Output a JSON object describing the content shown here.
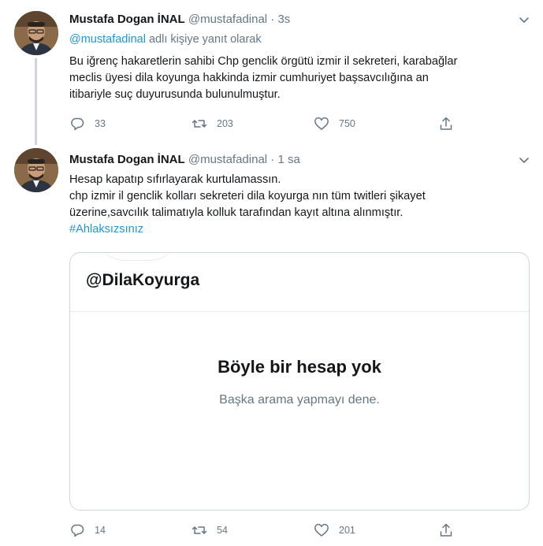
{
  "tweets": [
    {
      "name": "Mustafa Dogan İNAL",
      "handle": "@mustafadinal",
      "separator": "·",
      "time": "3s",
      "reply_mention": "@mustafadinal",
      "reply_suffix": " adlı kişiye yanıt olarak",
      "body_lines": [
        "Bu iğrenç hakaretlerin sahibi Chp genclik örgütü izmir il sekreteri, karabağlar",
        "meclis üyesi dila koyunga hakkinda izmir cumhuriyet başsavcılığına an",
        "itibariyle suç duyurusunda bulunulmuştur."
      ],
      "counts": {
        "reply": "33",
        "retweet": "203",
        "like": "750"
      }
    },
    {
      "name": "Mustafa Dogan İNAL",
      "handle": "@mustafadinal",
      "separator": "·",
      "time": "1 sa",
      "body_lines": [
        "Hesap kapatıp sıfırlayarak kurtulamassın.",
        "chp izmir il genclik kolları sekreteri dila koyurga nın tüm twitleri şikayet",
        "üzerine,savcılık talimatıyla kolluk tarafından kayıt altına alınmıştır."
      ],
      "hashtag": "#Ahlaksızsınız",
      "card": {
        "handle": "@DilaKoyurga",
        "title": "Böyle bir hesap yok",
        "subtitle": "Başka arama yapmayı dene."
      },
      "counts": {
        "reply": "14",
        "retweet": "54",
        "like": "201"
      }
    }
  ],
  "icons": {
    "reply": "reply-icon",
    "retweet": "retweet-icon",
    "like": "heart-icon",
    "share": "share-icon",
    "menu": "chevron-down-icon"
  },
  "colors": {
    "link": "#1b95e0",
    "secondary_text": "#657786",
    "border": "#ccd6dd",
    "thread_line": "#ccd6dd"
  }
}
